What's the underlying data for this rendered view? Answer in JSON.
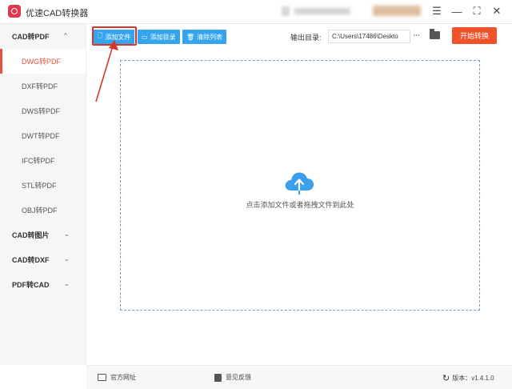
{
  "app": {
    "title": "优速CAD转换器"
  },
  "window_controls": {
    "menu": "☰",
    "minimize": "—",
    "maximize": "⛶",
    "close": "✕"
  },
  "sidebar": {
    "groups": [
      {
        "label": "CAD转PDF",
        "expanded": true,
        "chevron": "^",
        "items": [
          "DWG转PDF",
          "DXF转PDF",
          "DWS转PDF",
          "DWT转PDF",
          "IFC转PDF",
          "STL转PDF",
          "OBJ转PDF"
        ],
        "active": "DWG转PDF"
      },
      {
        "label": "CAD转图片",
        "expanded": false,
        "chevron": "⌄"
      },
      {
        "label": "CAD转DXF",
        "expanded": false,
        "chevron": "⌄"
      },
      {
        "label": "PDF转CAD",
        "expanded": false,
        "chevron": "⌄"
      }
    ]
  },
  "toolbar": {
    "add_file": "添加文件",
    "add_folder": "添加目录",
    "clear_list": "清除列表",
    "output_label": "输出目录:",
    "output_path": "C:\\Users\\17486\\Deskto",
    "more": "···",
    "start": "开始转换"
  },
  "drop_area": {
    "hint": "点击添加文件或者拖拽文件到此处"
  },
  "footer": {
    "website": "官方网址",
    "feedback": "意见反馈",
    "version": "版本：v1.4.1.0"
  },
  "colors": {
    "accent": "#f0532c",
    "active_text": "#e5533a",
    "toolbar_blue": "#35a5ee",
    "highlight": "#d8362c"
  }
}
